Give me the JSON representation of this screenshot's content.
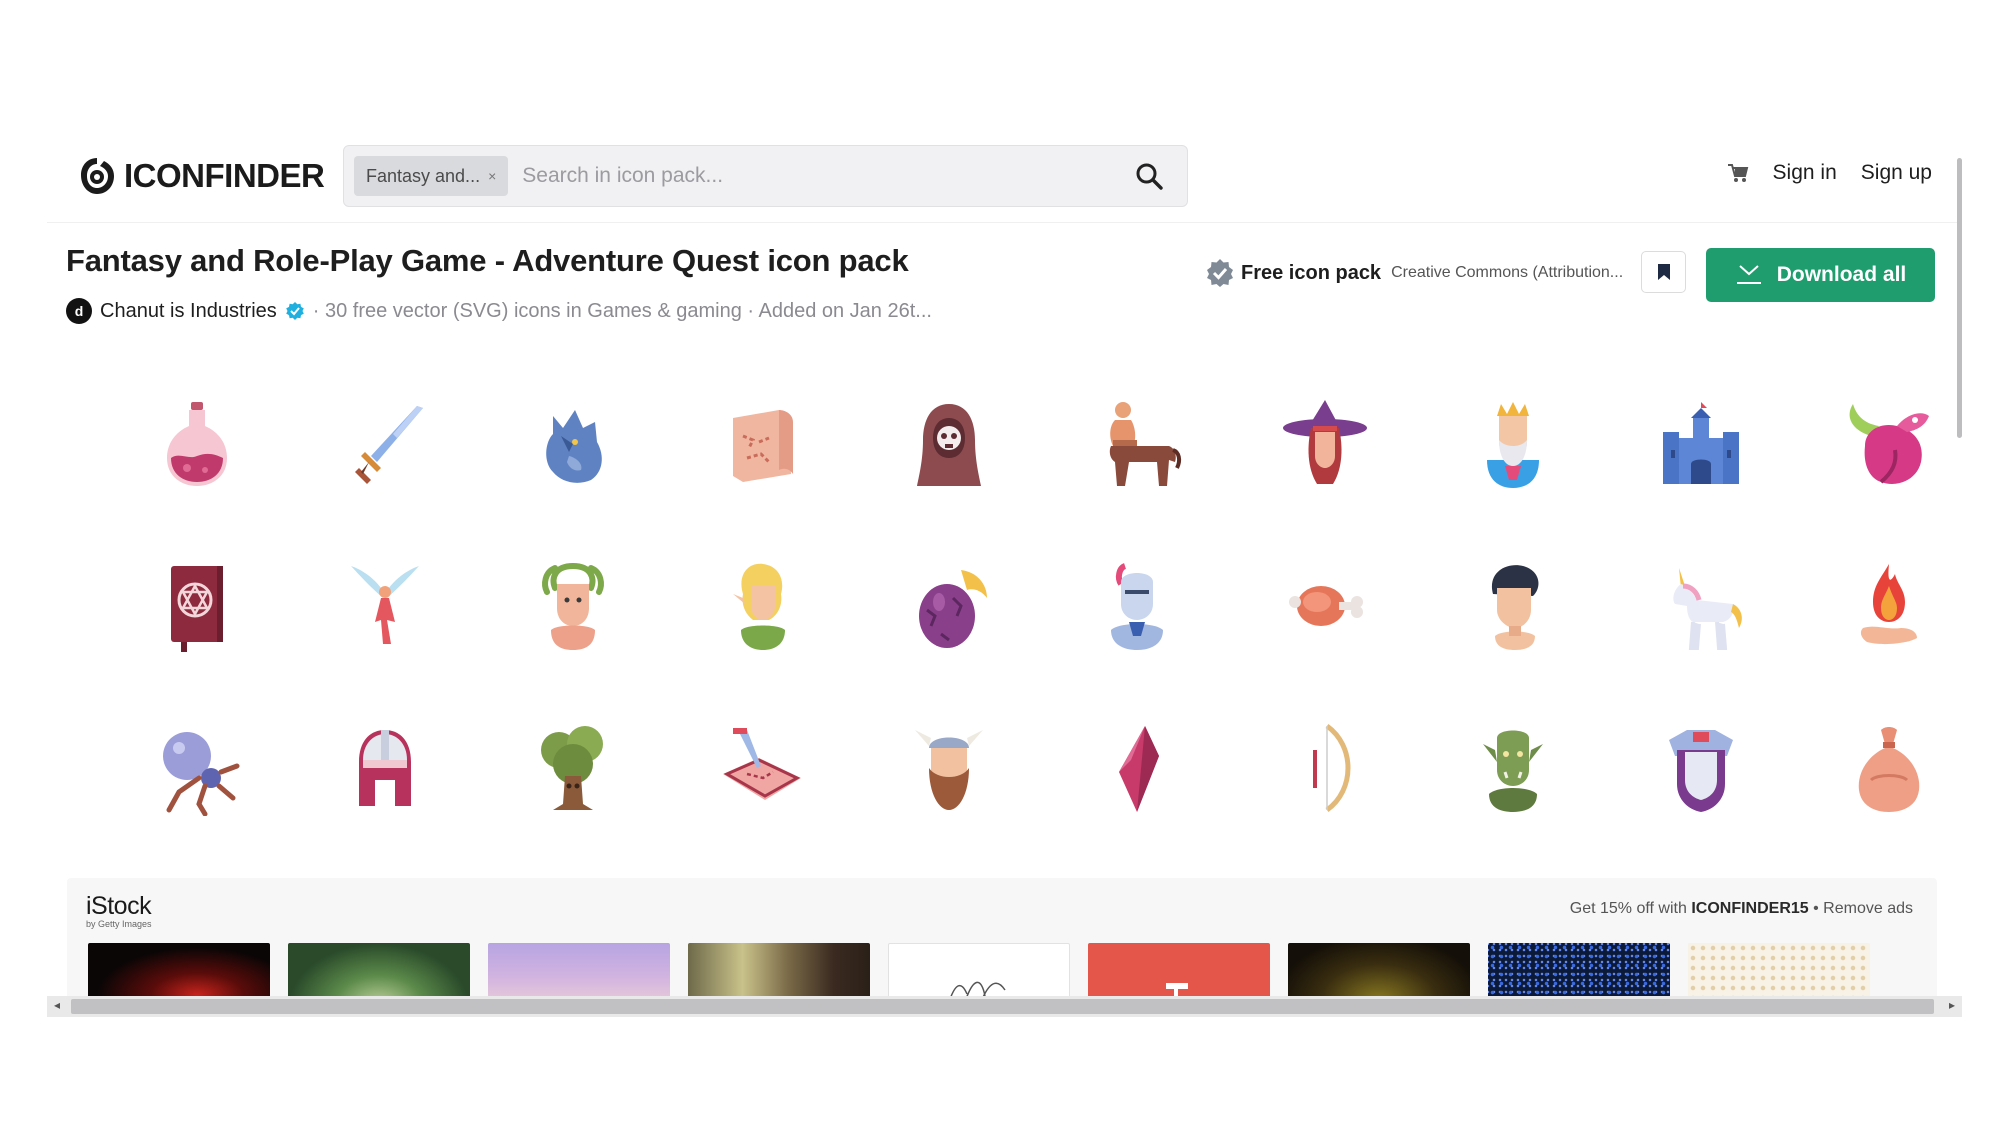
{
  "brand": {
    "name": "ICONFINDER",
    "logo_icon": "iconfinder-logo-icon"
  },
  "search": {
    "chip_label": "Fantasy and...",
    "chip_close": "×",
    "placeholder": "Search in icon pack...",
    "icon": "search-icon"
  },
  "nav": {
    "cart_icon": "cart-icon",
    "sign_in": "Sign in",
    "sign_up": "Sign up"
  },
  "pack": {
    "title": "Fantasy and Role-Play Game - Adventure Quest icon pack",
    "author": "Chanut is Industries",
    "meta": "· 30 free vector (SVG) icons in Games & gaming · Added on Jan 26t...",
    "free_label": "Free icon pack",
    "license": "Creative Commons (Attribution...",
    "download_label": "Download all"
  },
  "icons": [
    "potion-icon",
    "sword-icon",
    "werewolf-icon",
    "map-scroll-icon",
    "grim-reaper-icon",
    "centaur-icon",
    "witch-icon",
    "king-icon",
    "castle-icon",
    "dragon-icon",
    "spellbook-icon",
    "fairy-icon",
    "medusa-icon",
    "elf-icon",
    "dragon-egg-icon",
    "knight-icon",
    "meat-icon",
    "hero-icon",
    "unicorn-icon",
    "fire-magic-icon",
    "spider-icon",
    "helmet-icon",
    "tree-ent-icon",
    "treasure-map-icon",
    "viking-icon",
    "crystal-icon",
    "bow-icon",
    "orc-icon",
    "armor-icon",
    "money-bag-icon"
  ],
  "ad": {
    "brand": "iStock",
    "brand_sub": "by Getty Images",
    "promo_prefix": "Get 15% off with",
    "promo_code": "ICONFINDER15",
    "promo_suffix": "• Remove ads",
    "thumbs": [
      "dark-red",
      "forest-tunnel",
      "purple-sky",
      "forest",
      "sketch",
      "red-figure",
      "gold-dark",
      "blue-dots",
      "gold-pattern"
    ]
  },
  "colors": {
    "accent": "#1f9d6e",
    "verified": "#1fb0e0"
  }
}
